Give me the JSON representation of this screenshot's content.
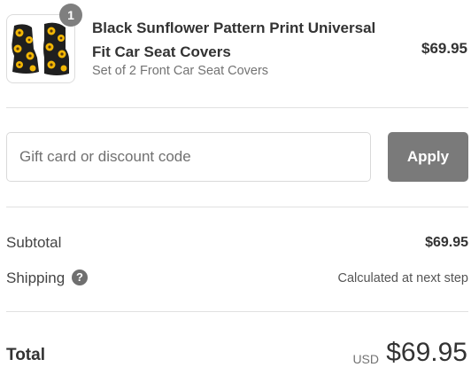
{
  "product": {
    "quantity": "1",
    "title": "Black Sunflower Pattern Print Universal Fit Car Seat Covers",
    "variant": "Set of 2 Front Car Seat Covers",
    "price": "$69.95",
    "image_icon": "sunflower-seat-covers-image"
  },
  "discount": {
    "placeholder": "Gift card or discount code",
    "value": "",
    "apply_label": "Apply"
  },
  "summary": {
    "subtotal_label": "Subtotal",
    "subtotal_value": "$69.95",
    "shipping_label": "Shipping",
    "shipping_help_icon": "question-circle-icon",
    "shipping_help_glyph": "?",
    "shipping_value": "Calculated at next step",
    "total_label": "Total",
    "currency": "USD",
    "total_value": "$69.95"
  },
  "colors": {
    "badge": "#7f7f7f",
    "apply_button": "#7a7a7a",
    "divider": "#e1e1e1",
    "text": "#333333",
    "muted_text": "#737373"
  }
}
